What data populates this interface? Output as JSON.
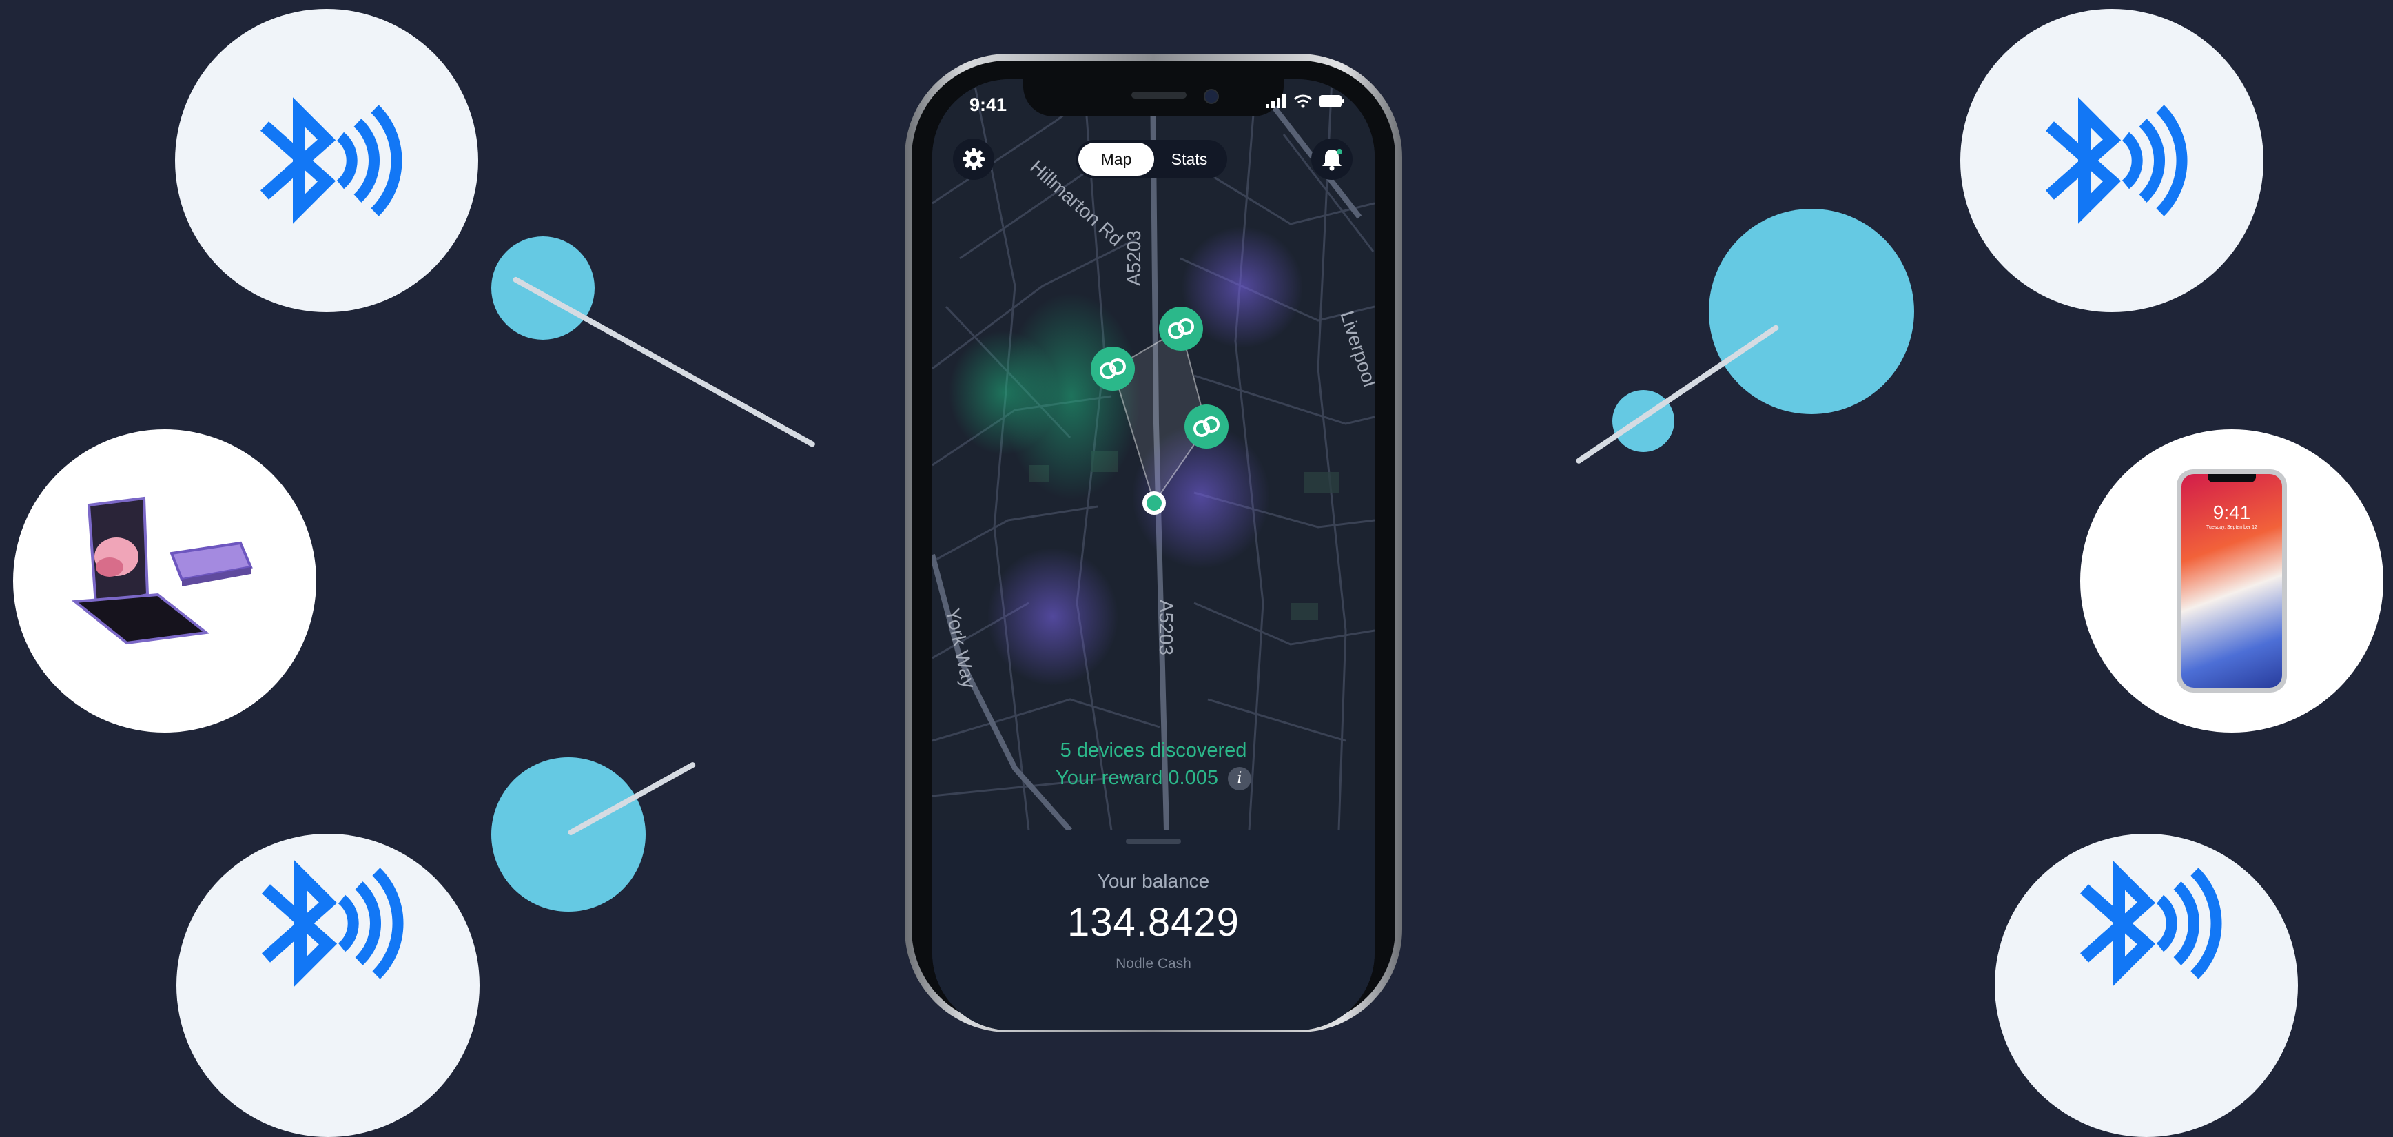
{
  "status_bar": {
    "time": "9:41"
  },
  "map": {
    "segmented_control": {
      "map_label": "Map",
      "stats_label": "Stats",
      "selected": "Map"
    },
    "street_labels": [
      "Hillmarton Rd",
      "A5203",
      "A5203",
      "York Way",
      "Liverpool"
    ],
    "discovery": {
      "devices_text": "5 devices discovered",
      "reward_text": "Your reward 0.005",
      "info_icon_glyph": "i"
    }
  },
  "balance": {
    "label": "Your balance",
    "value": "134.8429",
    "currency": "Nodle Cash"
  },
  "illustrations": {
    "phone_screen_time": "9:41",
    "phone_screen_date": "Tuesday, September 12",
    "icons": [
      "bluetooth-icon",
      "foldable-phone",
      "iphone-x",
      "signal-waves-icon"
    ]
  },
  "colors": {
    "background": "#1f2538",
    "accent_teal": "#65c9e3",
    "bluetooth_blue": "#1277f5",
    "discovery_green": "#2bb88a",
    "heat_purple": "#6f5cd6",
    "heat_green": "#1fb47f"
  }
}
